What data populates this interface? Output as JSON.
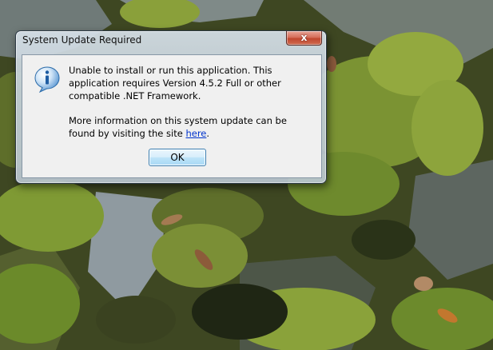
{
  "wallpaper": {
    "description_colors": {
      "moss_dark": "#3f4a24",
      "moss_bright": "#8aa03a",
      "rock_grey": "#8b969c"
    }
  },
  "dialog": {
    "title": "System Update Required",
    "close_label": "x",
    "icon": "information-icon",
    "message_line1": "Unable to install or run this application. This application requires Version 4.5.2 Full or other compatible .NET Framework.",
    "message_line2_prefix": "More information on this system update can be found by visiting the site ",
    "link_text": "here",
    "message_line2_suffix": ".",
    "ok_label": "OK"
  },
  "colors": {
    "link": "#0033cc",
    "close_button": "#c1472f",
    "ok_button_border": "#3c7fb1"
  }
}
